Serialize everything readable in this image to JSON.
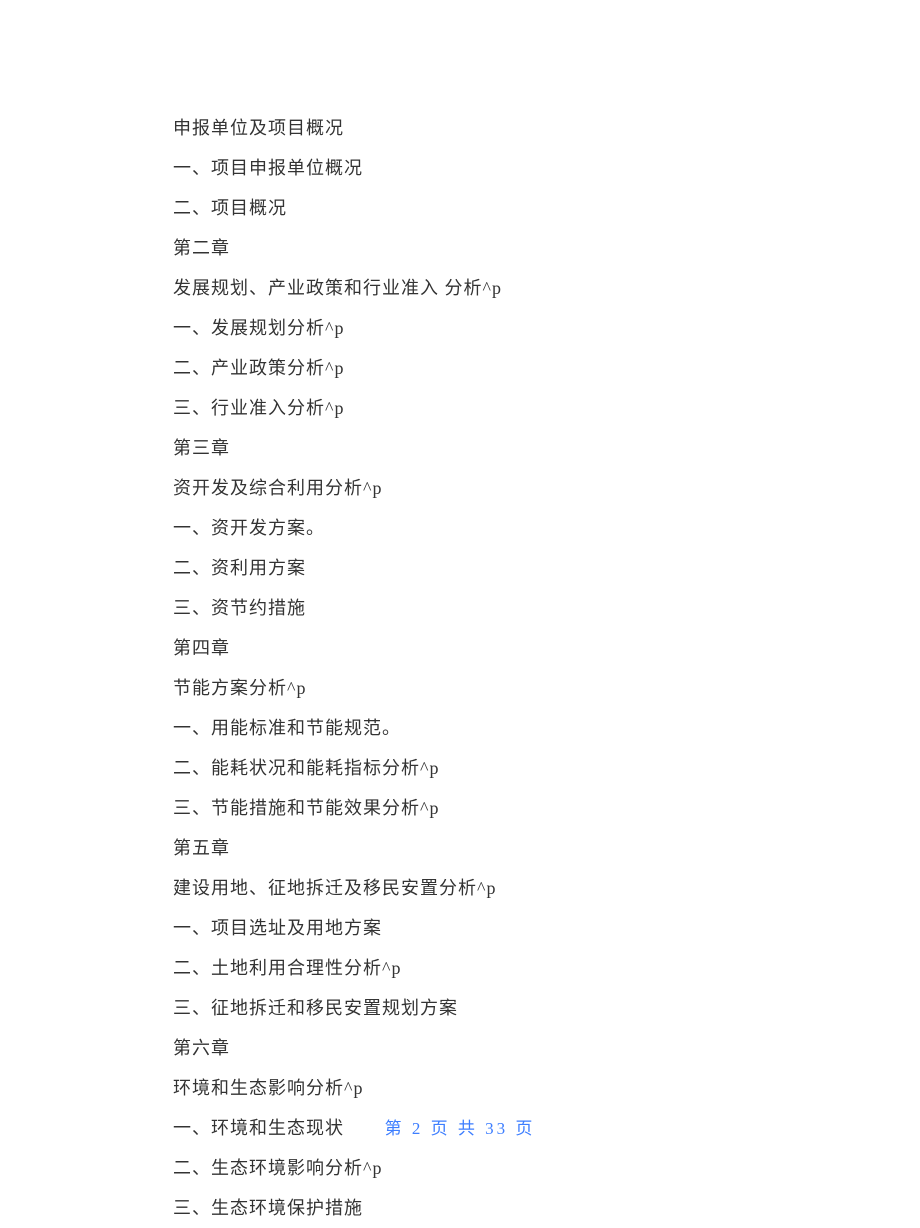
{
  "lines": [
    "申报单位及项目概况",
    "一、项目申报单位概况",
    "二、项目概况",
    "第二章",
    "发展规划、产业政策和行业准入 分析^p",
    "一、发展规划分析^p",
    "二、产业政策分析^p",
    "三、行业准入分析^p",
    "第三章",
    "资开发及综合利用分析^p",
    "一、资开发方案。",
    "二、资利用方案",
    "三、资节约措施",
    "第四章",
    "节能方案分析^p",
    "一、用能标准和节能规范。",
    "二、能耗状况和能耗指标分析^p",
    "三、节能措施和节能效果分析^p",
    "第五章",
    "建设用地、征地拆迁及移民安置分析^p",
    "一、项目选址及用地方案",
    "二、土地利用合理性分析^p",
    "三、征地拆迁和移民安置规划方案",
    "第六章",
    "环境和生态影响分析^p",
    "一、环境和生态现状",
    "二、生态环境影响分析^p",
    "三、生态环境保护措施"
  ],
  "footer": "第 2 页 共 33 页"
}
